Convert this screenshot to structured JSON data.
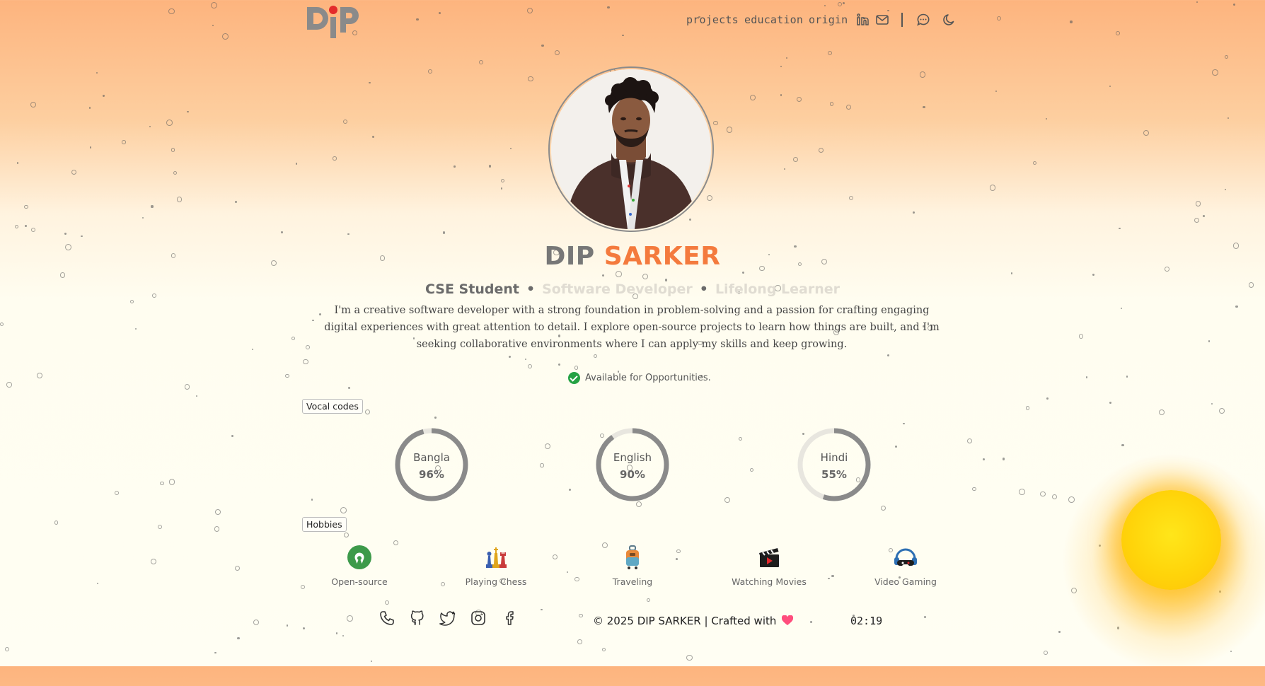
{
  "header": {
    "logo_text": "DiP",
    "nav": [
      "projects",
      "education",
      "origin"
    ],
    "icons": [
      "linkedin-icon",
      "mail-icon",
      "chat-icon",
      "moon-icon"
    ]
  },
  "profile": {
    "first_name": "DIP",
    "last_name": "SARKER",
    "roles": [
      "CSE Student",
      "Software Developer",
      "Lifelong Learner"
    ],
    "bio": "I'm a creative software developer with a strong foundation in problem-solving and a passion for crafting engaging digital experiences with great attention to detail. I explore open-source projects to learn how things are built, and I'm seeking collaborative environments where I can apply my skills and keep growing.",
    "availability": "Available for Opportunities."
  },
  "languages": {
    "title": "Vocal codes",
    "items": [
      {
        "name": "Bangla",
        "value": "96%",
        "fraction": 0.96
      },
      {
        "name": "English",
        "value": "90%",
        "fraction": 0.9
      },
      {
        "name": "Hindi",
        "value": "55%",
        "fraction": 0.55
      }
    ]
  },
  "hobbies": {
    "title": "Hobbies",
    "items": [
      {
        "label": "Open-source",
        "icon": "open-source-icon"
      },
      {
        "label": "Playing Chess",
        "icon": "chess-icon"
      },
      {
        "label": "Traveling",
        "icon": "luggage-icon"
      },
      {
        "label": "Watching Movies",
        "icon": "clapperboard-icon"
      },
      {
        "label": "Video Gaming",
        "icon": "gamer-headset-icon"
      }
    ]
  },
  "footer": {
    "social_icons": [
      "phone-icon",
      "github-icon",
      "twitter-icon",
      "instagram-icon",
      "facebook-icon"
    ],
    "copyright": "© 2025 DIP SARKER | Crafted with",
    "clock": "02:19"
  },
  "colors": {
    "accent": "#f47a3d",
    "gauge": "#8a8a8a",
    "gauge_track": "#e8e6df",
    "available": "#25a244",
    "heart": "#ff4d7d"
  }
}
